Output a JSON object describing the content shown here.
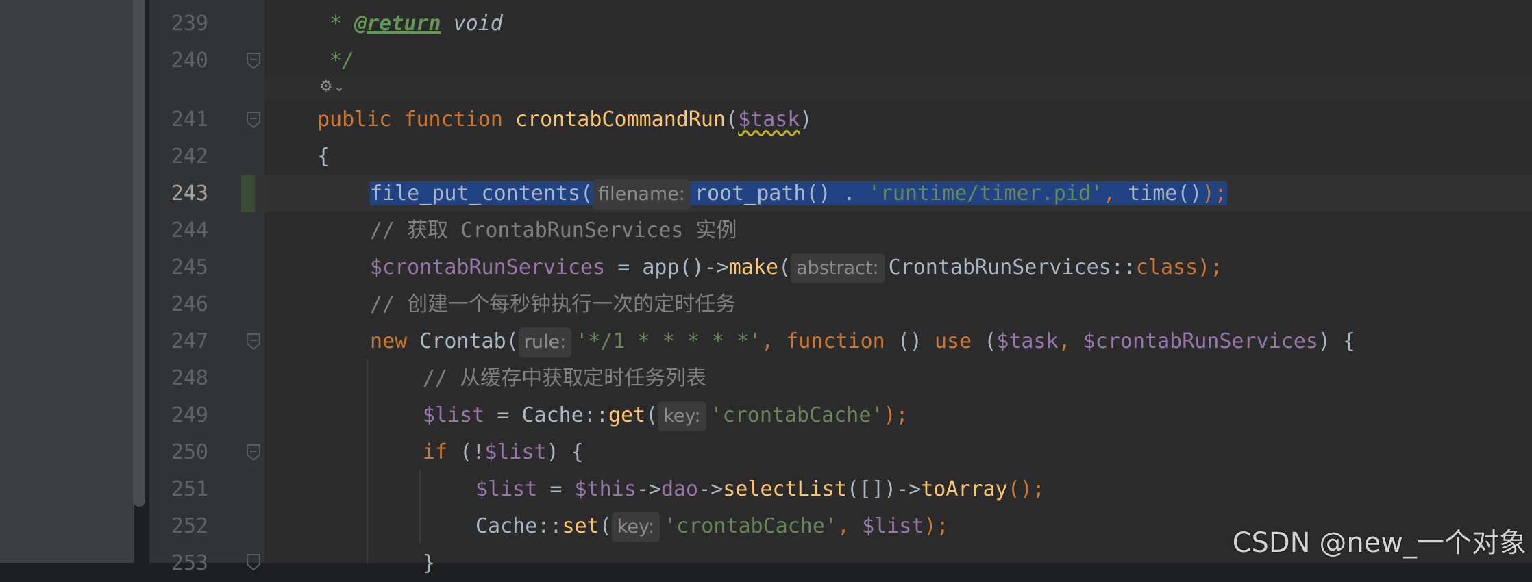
{
  "line_numbers": [
    "239",
    "240",
    "241",
    "242",
    "243",
    "244",
    "245",
    "246",
    "247",
    "248",
    "249",
    "250",
    "251",
    "252",
    "253"
  ],
  "code": {
    "l239": {
      "star": "* ",
      "tag": "@return",
      "word": " void"
    },
    "l240": {
      "text": "*/"
    },
    "l241": {
      "kw_public": "public",
      "kw_function": "function",
      "name": "crontabCommandRun",
      "open": "(",
      "param": "$task",
      "close": ")"
    },
    "l242": {
      "text": "{"
    },
    "l243": {
      "call": "file_put_contents(",
      "hint": "filename:",
      "arg1": "root_path() . ",
      "str": "'runtime/timer.pid'",
      "sep": ", ",
      "call2": "time()",
      "end": ");"
    },
    "l244": {
      "text": "// 获取 CrontabRunServices 实例"
    },
    "l245": {
      "var": "$crontabRunServices",
      "op": " = app()->",
      "make": "make",
      "open": "(",
      "hint": "abstract:",
      "cls": "CrontabRunServices::",
      "kw_class": "class",
      "end": ");"
    },
    "l246": {
      "text": "// 创建一个每秒钟执行一次的定时任务"
    },
    "l247": {
      "kw_new": "new",
      "cls": " Crontab(",
      "hint": "rule:",
      "str": "'*/1 * * * * *'",
      "sep": ", ",
      "kw_function": "function",
      "paren": " () ",
      "kw_use": "use",
      "open": " (",
      "v1": "$task",
      "comma": ", ",
      "v2": "$crontabRunServices",
      "close": ") {"
    },
    "l248": {
      "text": "// 从缓存中获取定时任务列表"
    },
    "l249": {
      "var": "$list",
      "op": " = Cache::",
      "method": "get",
      "open": "(",
      "hint": "key:",
      "str": "'crontabCache'",
      "end": ");"
    },
    "l250": {
      "kw_if": "if",
      "open": " (!",
      "var": "$list",
      "close": ") {"
    },
    "l251": {
      "var": "$list",
      "op": " = ",
      "this": "$this",
      "arrow1": "->",
      "dao": "dao",
      "arrow2": "->",
      "m1": "selectList",
      "args": "([])->",
      "m2": "toArray",
      "end": "();"
    },
    "l252": {
      "cls": "Cache::",
      "method": "set",
      "open": "(",
      "hint": "key:",
      "str": "'crontabCache'",
      "sep": ", ",
      "var": "$list",
      "end": ");"
    },
    "l253": {
      "text": "}"
    }
  },
  "watermark": "CSDN @new_一个对象",
  "colors": {
    "keyword": "#cc7832",
    "function": "#ffc66d",
    "variable": "#9876aa",
    "string": "#6a8759",
    "comment": "#808080",
    "selection": "#214283"
  },
  "icons": {
    "ai_hint": "ai-assist-icon",
    "fold": "fold-marker-icon"
  }
}
